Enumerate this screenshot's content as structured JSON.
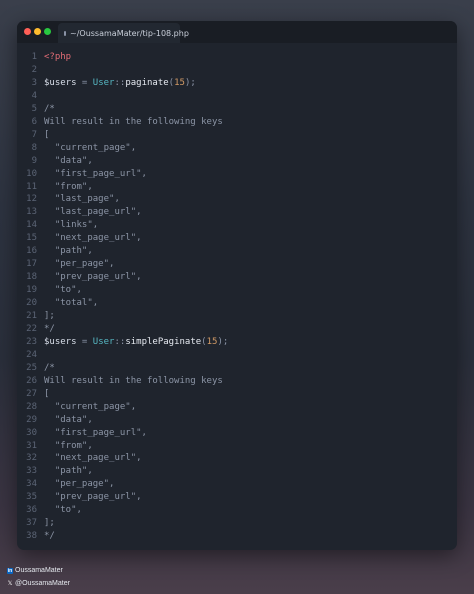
{
  "window": {
    "tab_label": "~/OussamaMater/tip-108.php",
    "tab_icon": "link-icon"
  },
  "code_lines": [
    {
      "n": "1",
      "tokens": [
        {
          "t": "<?php",
          "c": "php"
        }
      ]
    },
    {
      "n": "2",
      "tokens": []
    },
    {
      "n": "3",
      "tokens": [
        {
          "t": "$users",
          "c": "var"
        },
        {
          "t": " = ",
          "c": "op"
        },
        {
          "t": "User",
          "c": "class"
        },
        {
          "t": "::",
          "c": "op"
        },
        {
          "t": "paginate",
          "c": "fn"
        },
        {
          "t": "(",
          "c": "op"
        },
        {
          "t": "15",
          "c": "num"
        },
        {
          "t": ");",
          "c": "op"
        }
      ]
    },
    {
      "n": "4",
      "tokens": []
    },
    {
      "n": "5",
      "tokens": [
        {
          "t": "/*",
          "c": "com"
        }
      ]
    },
    {
      "n": "6",
      "tokens": [
        {
          "t": "Will result in the following keys",
          "c": "com"
        }
      ]
    },
    {
      "n": "7",
      "tokens": [
        {
          "t": "[",
          "c": "com"
        }
      ]
    },
    {
      "n": "8",
      "tokens": [
        {
          "t": "  \"current_page\",",
          "c": "com"
        }
      ]
    },
    {
      "n": "9",
      "tokens": [
        {
          "t": "  \"data\",",
          "c": "com"
        }
      ]
    },
    {
      "n": "10",
      "tokens": [
        {
          "t": "  \"first_page_url\",",
          "c": "com"
        }
      ]
    },
    {
      "n": "11",
      "tokens": [
        {
          "t": "  \"from\",",
          "c": "com"
        }
      ]
    },
    {
      "n": "12",
      "tokens": [
        {
          "t": "  \"last_page\",",
          "c": "com"
        }
      ]
    },
    {
      "n": "13",
      "tokens": [
        {
          "t": "  \"last_page_url\",",
          "c": "com"
        }
      ]
    },
    {
      "n": "14",
      "tokens": [
        {
          "t": "  \"links\",",
          "c": "com"
        }
      ]
    },
    {
      "n": "15",
      "tokens": [
        {
          "t": "  \"next_page_url\",",
          "c": "com"
        }
      ]
    },
    {
      "n": "16",
      "tokens": [
        {
          "t": "  \"path\",",
          "c": "com"
        }
      ]
    },
    {
      "n": "17",
      "tokens": [
        {
          "t": "  \"per_page\",",
          "c": "com"
        }
      ]
    },
    {
      "n": "18",
      "tokens": [
        {
          "t": "  \"prev_page_url\",",
          "c": "com"
        }
      ]
    },
    {
      "n": "19",
      "tokens": [
        {
          "t": "  \"to\",",
          "c": "com"
        }
      ]
    },
    {
      "n": "20",
      "tokens": [
        {
          "t": "  \"total\",",
          "c": "com"
        }
      ]
    },
    {
      "n": "21",
      "tokens": [
        {
          "t": "];",
          "c": "com"
        }
      ]
    },
    {
      "n": "22",
      "tokens": [
        {
          "t": "*/",
          "c": "com"
        }
      ]
    },
    {
      "n": "23",
      "tokens": [
        {
          "t": "$users",
          "c": "var"
        },
        {
          "t": " = ",
          "c": "op"
        },
        {
          "t": "User",
          "c": "class"
        },
        {
          "t": "::",
          "c": "op"
        },
        {
          "t": "simplePaginate",
          "c": "fn"
        },
        {
          "t": "(",
          "c": "op"
        },
        {
          "t": "15",
          "c": "num"
        },
        {
          "t": ");",
          "c": "op"
        }
      ]
    },
    {
      "n": "24",
      "tokens": []
    },
    {
      "n": "25",
      "tokens": [
        {
          "t": "/*",
          "c": "com"
        }
      ]
    },
    {
      "n": "26",
      "tokens": [
        {
          "t": "Will result in the following keys",
          "c": "com"
        }
      ]
    },
    {
      "n": "27",
      "tokens": [
        {
          "t": "[",
          "c": "com"
        }
      ]
    },
    {
      "n": "28",
      "tokens": [
        {
          "t": "  \"current_page\",",
          "c": "com"
        }
      ]
    },
    {
      "n": "29",
      "tokens": [
        {
          "t": "  \"data\",",
          "c": "com"
        }
      ]
    },
    {
      "n": "30",
      "tokens": [
        {
          "t": "  \"first_page_url\",",
          "c": "com"
        }
      ]
    },
    {
      "n": "31",
      "tokens": [
        {
          "t": "  \"from\",",
          "c": "com"
        }
      ]
    },
    {
      "n": "32",
      "tokens": [
        {
          "t": "  \"next_page_url\",",
          "c": "com"
        }
      ]
    },
    {
      "n": "33",
      "tokens": [
        {
          "t": "  \"path\",",
          "c": "com"
        }
      ]
    },
    {
      "n": "34",
      "tokens": [
        {
          "t": "  \"per_page\",",
          "c": "com"
        }
      ]
    },
    {
      "n": "35",
      "tokens": [
        {
          "t": "  \"prev_page_url\",",
          "c": "com"
        }
      ]
    },
    {
      "n": "36",
      "tokens": [
        {
          "t": "  \"to\",",
          "c": "com"
        }
      ]
    },
    {
      "n": "37",
      "tokens": [
        {
          "t": "];",
          "c": "com"
        }
      ]
    },
    {
      "n": "38",
      "tokens": [
        {
          "t": "*/",
          "c": "com"
        }
      ]
    }
  ],
  "credits": {
    "linkedin_icon": "linkedin-icon",
    "linkedin_label": "OussamaMater",
    "x_icon": "x-icon",
    "x_label": "@OussamaMater"
  },
  "colors": {
    "window_bg": "#1f242d",
    "titlebar_bg": "#191d24",
    "keyword": "#e06c75",
    "class": "#56b6c2",
    "number": "#d19a66",
    "comment": "#8c95a6"
  }
}
